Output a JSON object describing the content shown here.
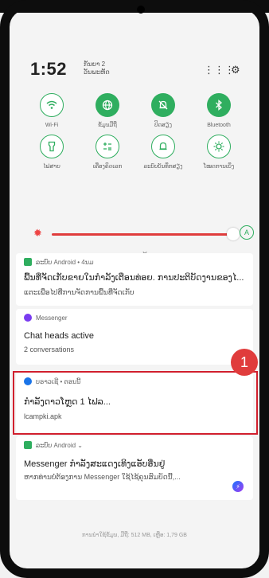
{
  "status": {
    "time": "1:52",
    "date_line1": "ກັນຍາ 2",
    "date_line2": "ວັນພະຫັດ",
    "grid_icon": "grid-icon",
    "settings_icon": "gear-icon"
  },
  "tiles": [
    {
      "icon": "wifi-icon",
      "label": "Wi-Fi"
    },
    {
      "icon": "globe-icon",
      "label": "ຂໍ້ມູນມືຖື"
    },
    {
      "icon": "bell-off-icon",
      "label": "ປິດສຽງ"
    },
    {
      "icon": "bluetooth-icon",
      "label": "Bluetooth"
    },
    {
      "icon": "flashlight-icon",
      "label": "ໄຟສາຍ"
    },
    {
      "icon": "calculator-icon",
      "label": "ເຄື່ອງຄິດເລກ"
    },
    {
      "icon": "bell-icon",
      "label": "ລະບົບບັນທຶກສຽງ"
    },
    {
      "icon": "brightness-icon",
      "label": "ໂໝດການເບິ່ງ"
    }
  ],
  "brightness": {
    "icon": "sun-icon",
    "auto_label": "A",
    "level": 0.92
  },
  "notifications": [
    {
      "app": "ລະບົບ Android • 4ນມ",
      "title": "ພື້ນທີ່ຈັດເກັບຂາຍໃນກຳລັງເຕືອນທ່ອຍ. ການປະຕິບັດງານຂອງໄ...",
      "body": "ແຕະເພື່ອໄປທີ່ການຈັດການພື້ນທີ່ຈັດເກັບ"
    },
    {
      "app": "Messenger",
      "title": "Chat heads active",
      "body": "2 conversations"
    },
    {
      "app": "ບຣາວເຊີ • ຕອນນີ້",
      "title": "ກຳລັງດາວໂຫຼດ 1 ໄຟລ...",
      "body": "lcampki.apk"
    },
    {
      "app": "ລະບົບ Android ⌄",
      "title": "Messenger ກຳລັງສະແດງເທິງແອັບອື່ນຢູ່",
      "body": "ຫາກທ່ານບໍ່ຕ້ອງການ Messenger ໃຊ້ໄຊ້ຄຸນສົມບັດນີ້,..."
    }
  ],
  "badge": "1",
  "storage": "ການນຳໃຊ້ຂໍ້ມູນ, ມືຖື: 512 MB, ເຫຼືອ: 1,79 GB",
  "colors": {
    "accent": "#2fae5f",
    "highlight": "#d11f2d"
  }
}
